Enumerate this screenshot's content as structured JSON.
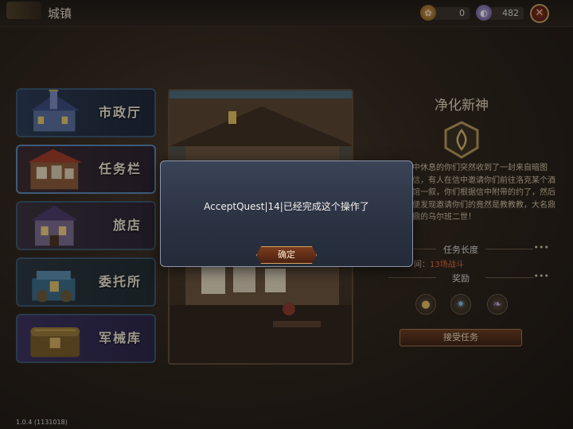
{
  "header": {
    "title": "城镇",
    "resource_1": "0",
    "resource_2": "482",
    "close_glyph": "✕"
  },
  "sidebar": {
    "items": [
      {
        "label": "市政厅",
        "icon": "town-hall-icon",
        "selected": false
      },
      {
        "label": "任务栏",
        "icon": "quest-board-icon",
        "selected": true
      },
      {
        "label": "旅店",
        "icon": "inn-icon",
        "selected": false
      },
      {
        "label": "委托所",
        "icon": "commission-icon",
        "selected": false
      },
      {
        "label": "军械库",
        "icon": "armory-icon",
        "selected": false
      }
    ]
  },
  "quest": {
    "title": "净化新神",
    "description": "中休息的你们突然收到了一封来自暗图信，有人在信中邀请你们前往洛克某个酒馆一叙，你们根据信中附带的约了，然后便发现邀请你们的竟然是教教教，大名鼎鼎的乌尔班二世！",
    "task_length_header": "任务长度",
    "task_length_label": "间：",
    "task_length_value": "13场战斗",
    "reward_header": "奖励",
    "rewards": [
      "gold-coin-icon",
      "blue-crystal-icon",
      "feather-token-icon"
    ],
    "accept_label": "接受任务",
    "more": "•••"
  },
  "dialog": {
    "message": "AcceptQuest|14|已经完成这个操作了",
    "ok_label": "确定"
  },
  "footer": {
    "version": "1.0.4 (1131018)"
  },
  "colors": {
    "accent_orange": "#e46a3a",
    "dialog_bg": "#2c3445",
    "sidebar_border": "#3a5670"
  }
}
